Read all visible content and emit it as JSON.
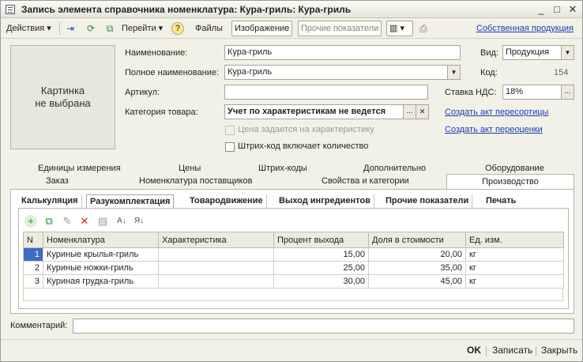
{
  "window": {
    "title": "Запись элемента справочника номенклатура: Кура-гриль: Кура-гриль",
    "controls": [
      "_",
      "□",
      "✕"
    ]
  },
  "toolbar": {
    "actions_label": "Действия",
    "goto_label": "Перейти",
    "files_label": "Файлы",
    "image_label": "Изображение",
    "other_metrics_label": "Прочие показатели",
    "own_production_link": "Собственная продукция",
    "help_glyph": "?"
  },
  "picture": {
    "line1": "Картинка",
    "line2": "не выбрана"
  },
  "form": {
    "name_label": "Наименование:",
    "name_value": "Кура-гриль",
    "full_name_label": "Полное наименование:",
    "full_name_value": "Кура-гриль",
    "article_label": "Артикул:",
    "article_value": "",
    "category_label": "Категория товара:",
    "category_value": "Учет по характеристикам не ведется",
    "price_by_char_label": "Цена задается на характеристику",
    "barcode_label": "Штрих-код включает количество",
    "kind_label": "Вид:",
    "kind_value": "Продукция",
    "code_label": "Код:",
    "code_value": "154",
    "vat_label": "Ставка НДС:",
    "vat_value": "18%",
    "regrading_link": "Создать акт пересортицы",
    "revaluation_link": "Создать акт переоценки",
    "dots": "...",
    "clear": "✕"
  },
  "tabs_row1": [
    "Единицы измерения",
    "Цены",
    "Штрих-коды",
    "Дополнительно",
    "Оборудование"
  ],
  "tabs_row2": [
    "Заказ",
    "Номенклатура поставщиков",
    "Свойства и категории",
    "Производство"
  ],
  "subtabs": [
    "Калькуляция",
    "Разукомплектация",
    "Товародвижение",
    "Выход ингредиентов",
    "Прочие показатели",
    "Печать"
  ],
  "grid": {
    "headers": [
      "N",
      "Номенклатура",
      "Характеристика",
      "Процент выхода",
      "Доля в стоимости",
      "Ед. изм."
    ],
    "rows": [
      {
        "n": "1",
        "item": "Куриные крылья-гриль",
        "char": "",
        "pct": "15,00",
        "share": "20,00",
        "unit": "кг"
      },
      {
        "n": "2",
        "item": "Куриные ножки-гриль",
        "char": "",
        "pct": "25,00",
        "share": "35,00",
        "unit": "кг"
      },
      {
        "n": "3",
        "item": "Куриная грудка-гриль",
        "char": "",
        "pct": "30,00",
        "share": "45,00",
        "unit": "кг"
      }
    ]
  },
  "comment": {
    "label": "Комментарий:",
    "value": ""
  },
  "bottom": {
    "ok_label": "OK",
    "save_label": "Записать",
    "close_label": "Закрыть"
  },
  "colors": {
    "accent": "#3e6bc4",
    "link": "#1a3db4",
    "window_bg": "#f2f1e8"
  }
}
